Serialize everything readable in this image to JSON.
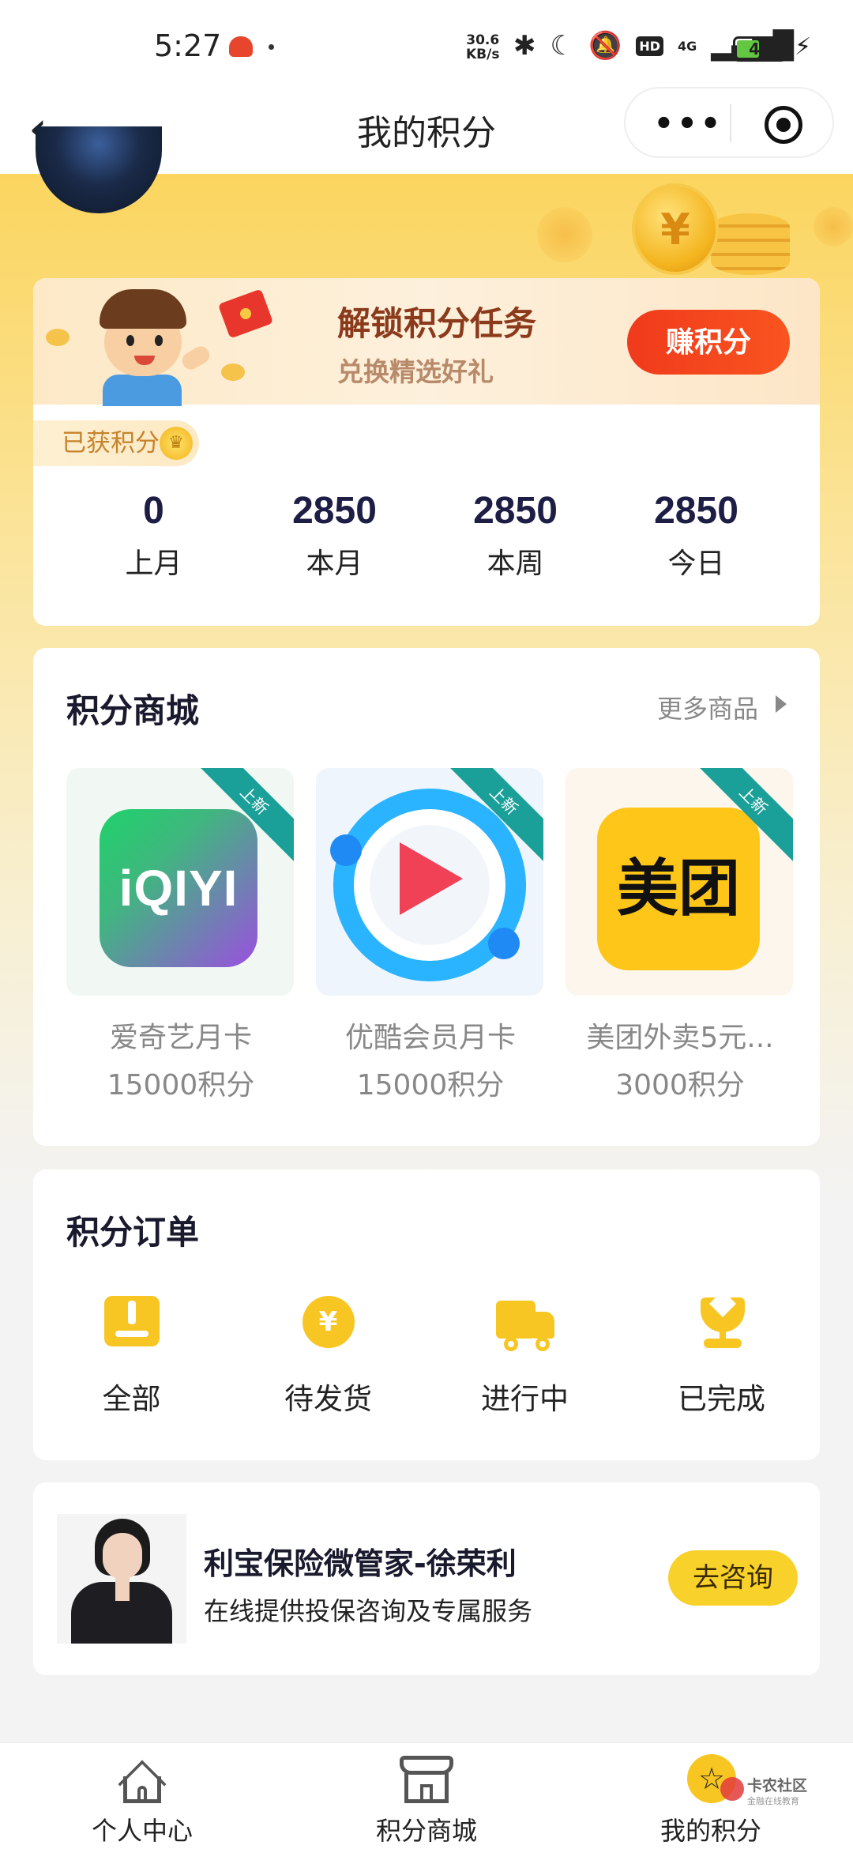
{
  "status_bar": {
    "time": "5:27",
    "net_speed_value": "30.6",
    "net_speed_unit": "KB/s",
    "hd": "HD",
    "network": "4G",
    "battery": "48",
    "battery_level": 0.48
  },
  "nav": {
    "back_glyph": "‹",
    "title": "我的积分",
    "more_glyph": "•••"
  },
  "task_banner": {
    "title": "解锁积分任务",
    "subtitle": "兑换精选好礼",
    "button": "赚积分"
  },
  "earned": {
    "label": "已获积分",
    "stats": [
      {
        "value": "0",
        "label": "上月"
      },
      {
        "value": "2850",
        "label": "本月"
      },
      {
        "value": "2850",
        "label": "本周"
      },
      {
        "value": "2850",
        "label": "今日"
      }
    ]
  },
  "mall": {
    "title": "积分商城",
    "more": "更多商品",
    "tag_new": "上新",
    "products": [
      {
        "name": "爱奇艺月卡",
        "price": "15000积分",
        "logo_text": "iQIYI"
      },
      {
        "name": "优酷会员月卡",
        "price": "15000积分"
      },
      {
        "name": "美团外卖5元...",
        "price": "3000积分",
        "logo_text": "美团"
      }
    ]
  },
  "orders": {
    "title": "积分订单",
    "items": [
      {
        "label": "全部",
        "icon": "alert-box-icon"
      },
      {
        "label": "待发货",
        "icon": "yen-coin-icon",
        "glyph": "¥"
      },
      {
        "label": "进行中",
        "icon": "truck-icon"
      },
      {
        "label": "已完成",
        "icon": "tulip-icon"
      }
    ]
  },
  "advisor": {
    "name": "利宝保险微管家-徐荣利",
    "description": "在线提供投保咨询及专属服务",
    "button": "去咨询"
  },
  "tab_bar": {
    "tabs": [
      {
        "label": "个人中心",
        "icon": "home-icon"
      },
      {
        "label": "积分商城",
        "icon": "shop-icon"
      },
      {
        "label": "我的积分",
        "icon": "star-coin-icon",
        "glyph": "☆"
      }
    ]
  },
  "watermark": {
    "title": "卡农社区",
    "subtitle": "金融在线教育"
  },
  "colors": {
    "accent_yellow": "#f8c622",
    "earn_button_red": "#f03a1c",
    "tag_teal": "#1aa098",
    "title_navy": "#1d1d45"
  }
}
